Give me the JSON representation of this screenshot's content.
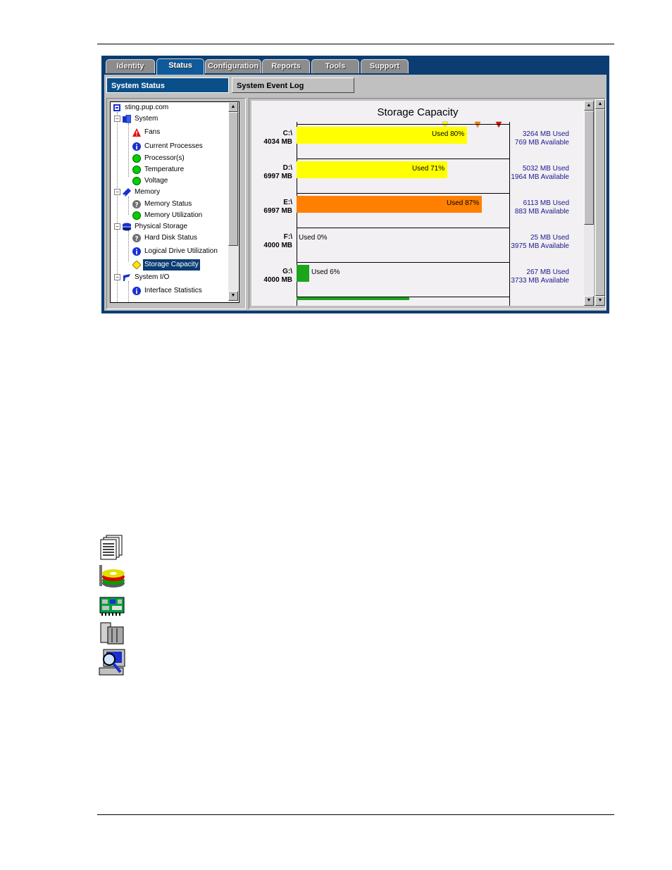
{
  "tabs": [
    {
      "label": "Identity",
      "active": false
    },
    {
      "label": "Status",
      "active": true
    },
    {
      "label": "Configuration",
      "active": false
    },
    {
      "label": "Reports",
      "active": false
    },
    {
      "label": "Tools",
      "active": false
    },
    {
      "label": "Support",
      "active": false
    }
  ],
  "subtabs": {
    "active": "System Status",
    "other": "System Event Log"
  },
  "tree": {
    "items": [
      {
        "label": "sting.pup.com",
        "icon": "server-icon"
      },
      {
        "label": "System",
        "icon": "system-icon"
      },
      {
        "label": "Fans",
        "icon": "warning-triangle-icon"
      },
      {
        "label": "Current Processes",
        "icon": "info-icon"
      },
      {
        "label": "Processor(s)",
        "icon": "status-ok-icon"
      },
      {
        "label": "Temperature",
        "icon": "status-ok-icon"
      },
      {
        "label": "Voltage",
        "icon": "status-ok-icon"
      },
      {
        "label": "Memory",
        "icon": "memory-icon"
      },
      {
        "label": "Memory Status",
        "icon": "unknown-icon"
      },
      {
        "label": "Memory Utilization",
        "icon": "status-ok-icon"
      },
      {
        "label": "Physical Storage",
        "icon": "storage-icon"
      },
      {
        "label": "Hard Disk Status",
        "icon": "unknown-icon"
      },
      {
        "label": "Logical Drive Utilization",
        "icon": "info-icon"
      },
      {
        "label": "Storage Capacity",
        "icon": "caution-diamond-icon",
        "selected": true
      },
      {
        "label": "System I/O",
        "icon": "system-io-icon"
      },
      {
        "label": "Interface Statistics",
        "icon": "info-icon"
      }
    ]
  },
  "colors": {
    "yellow": "#ffff00",
    "orange": "#ff8000",
    "green": "#1aa51a",
    "ok": "#00d000",
    "warn": "#e01010",
    "info": "#1a2fd0",
    "unknown": "#808080",
    "caution": "#ffe600"
  },
  "chart_data": {
    "type": "bar",
    "title": "Storage Capacity",
    "orientation": "horizontal",
    "xlim": [
      0,
      100
    ],
    "thresholds": [
      {
        "value": 70,
        "color": "yellow"
      },
      {
        "value": 85,
        "color": "orange"
      },
      {
        "value": 95,
        "color": "red"
      }
    ],
    "drives": [
      {
        "name": "C:\\",
        "size": "4034 MB",
        "percent": 80,
        "label": "Used 80%",
        "color": "yellow",
        "used": "3264 MB Used",
        "available": "769 MB Available"
      },
      {
        "name": "D:\\",
        "size": "6997 MB",
        "percent": 71,
        "label": "Used 71%",
        "color": "yellow",
        "used": "5032 MB Used",
        "available": "1964 MB Available"
      },
      {
        "name": "E:\\",
        "size": "6997 MB",
        "percent": 87,
        "label": "Used 87%",
        "color": "orange",
        "used": "6113 MB Used",
        "available": "883 MB Available"
      },
      {
        "name": "F:\\",
        "size": "4000 MB",
        "percent": 0,
        "label": "Used 0%",
        "color": "green",
        "used": "25 MB Used",
        "available": "3975 MB Available"
      },
      {
        "name": "G:\\",
        "size": "4000 MB",
        "percent": 6,
        "label": "Used 6%",
        "color": "green",
        "used": "267 MB Used",
        "available": "3733 MB Available"
      }
    ]
  },
  "doc_icons": [
    "report-document-icon",
    "disk-stack-icon",
    "network-board-icon",
    "server-tower-icon",
    "computer-magnifier-icon"
  ]
}
